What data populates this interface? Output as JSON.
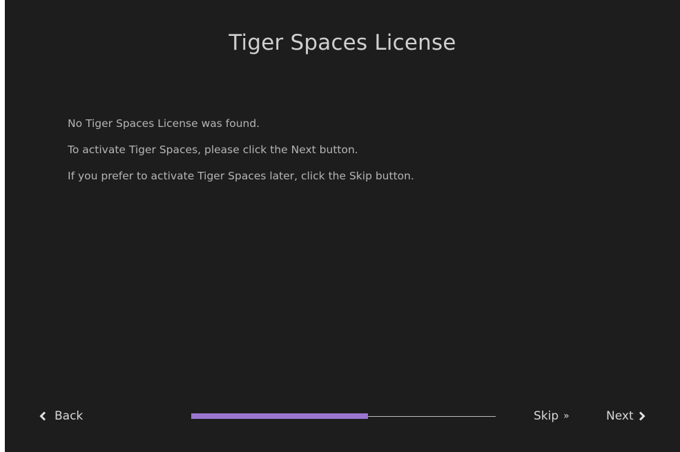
{
  "dialog": {
    "title": "Tiger Spaces License",
    "messages": [
      "No Tiger Spaces License was found.",
      "To activate Tiger Spaces, please click the Next button.",
      "If you prefer to activate Tiger Spaces later, click the Skip button."
    ]
  },
  "footer": {
    "back_label": "Back",
    "skip_label": "Skip",
    "next_label": "Next",
    "back_icon": "chevron-left-icon",
    "skip_icon": "double-chevron-right-icon",
    "next_icon": "chevron-right-icon",
    "progress": 0.58
  },
  "colors": {
    "background": "#1d1d1d",
    "text": "#b5b5b5",
    "accent": "#9a76d1"
  }
}
